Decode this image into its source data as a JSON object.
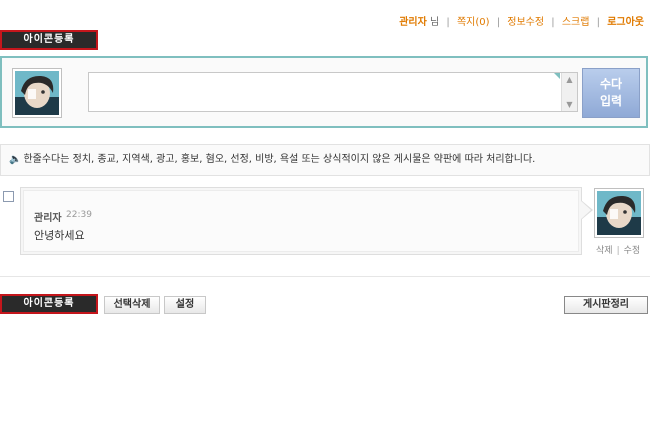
{
  "header": {
    "admin_name": "관리자",
    "honorific": "님",
    "links": [
      "쪽지(0)",
      "정보수정",
      "스크랩",
      "로그아웃"
    ]
  },
  "icon_register_label": "아이콘등록",
  "input": {
    "value": "",
    "submit_label": "수다\n입력"
  },
  "notice": {
    "text": "한줄수다는 정치, 종교, 지역색, 광고, 홍보, 혐오, 선정, 비방, 욕설 또는 상식적이지 않은 게시물은 약판에 따라 처리합니다."
  },
  "post": {
    "author": "관리자",
    "time": "22:39",
    "message": "안녕하세요",
    "actions": [
      "삭제",
      "수정"
    ]
  },
  "footer": {
    "delete_selected_label": "선택삭제",
    "settings_label": "설정",
    "board_manage_label": "게시판정리"
  },
  "colors": {
    "accent_orange": "#e07a00",
    "button_border_red": "#c4161c",
    "input_border_teal": "#7fbfbf",
    "submit_blue": "#8fa9d6"
  }
}
